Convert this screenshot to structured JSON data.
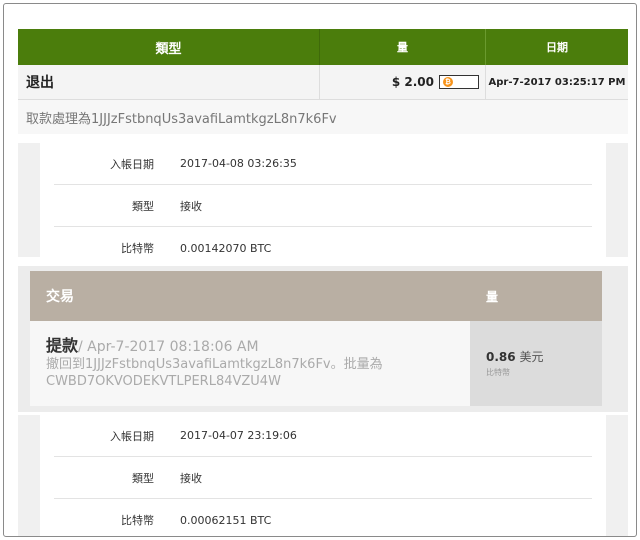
{
  "withdrawal_table": {
    "headers": {
      "type": "類型",
      "amount": "量",
      "date": "日期"
    },
    "row": {
      "type": "退出",
      "amount": "$ 2.00",
      "date": "Apr-7-2017 03:25:17 PM",
      "coin_icon": "bitcoin-icon"
    },
    "note": "取款處理為1JJJzFstbnqUs3avafiLamtkgzL8n7k6Fv"
  },
  "detail_1": {
    "rows": [
      {
        "label": "入帳日期",
        "value": "2017-04-08 03:26:35"
      },
      {
        "label": "類型",
        "value": "接收"
      },
      {
        "label": "比特幣",
        "value": "0.00142070 BTC"
      }
    ]
  },
  "transaction_card": {
    "headers": {
      "transaction": "交易",
      "amount": "量"
    },
    "kind": "提款",
    "datetime": "/ Apr-7-2017 08:18:06 AM",
    "description_line1": "撤回到1JJJzFstbnqUs3avafiLamtkgzL8n7k6Fv。批量為",
    "description_line2": "CWBD7OKVODEKVTLPERL84VZU4W",
    "amount_value": "0.86",
    "amount_currency": "美元",
    "amount_unit": "比特幣"
  },
  "detail_2": {
    "rows": [
      {
        "label": "入帳日期",
        "value": "2017-04-07 23:19:06"
      },
      {
        "label": "類型",
        "value": "接收"
      },
      {
        "label": "比特幣",
        "value": "0.00062151 BTC"
      }
    ]
  },
  "colors": {
    "green_header": "#4b7d0c",
    "tan_header": "#b9afa3",
    "bitcoin": "#f7931a"
  }
}
